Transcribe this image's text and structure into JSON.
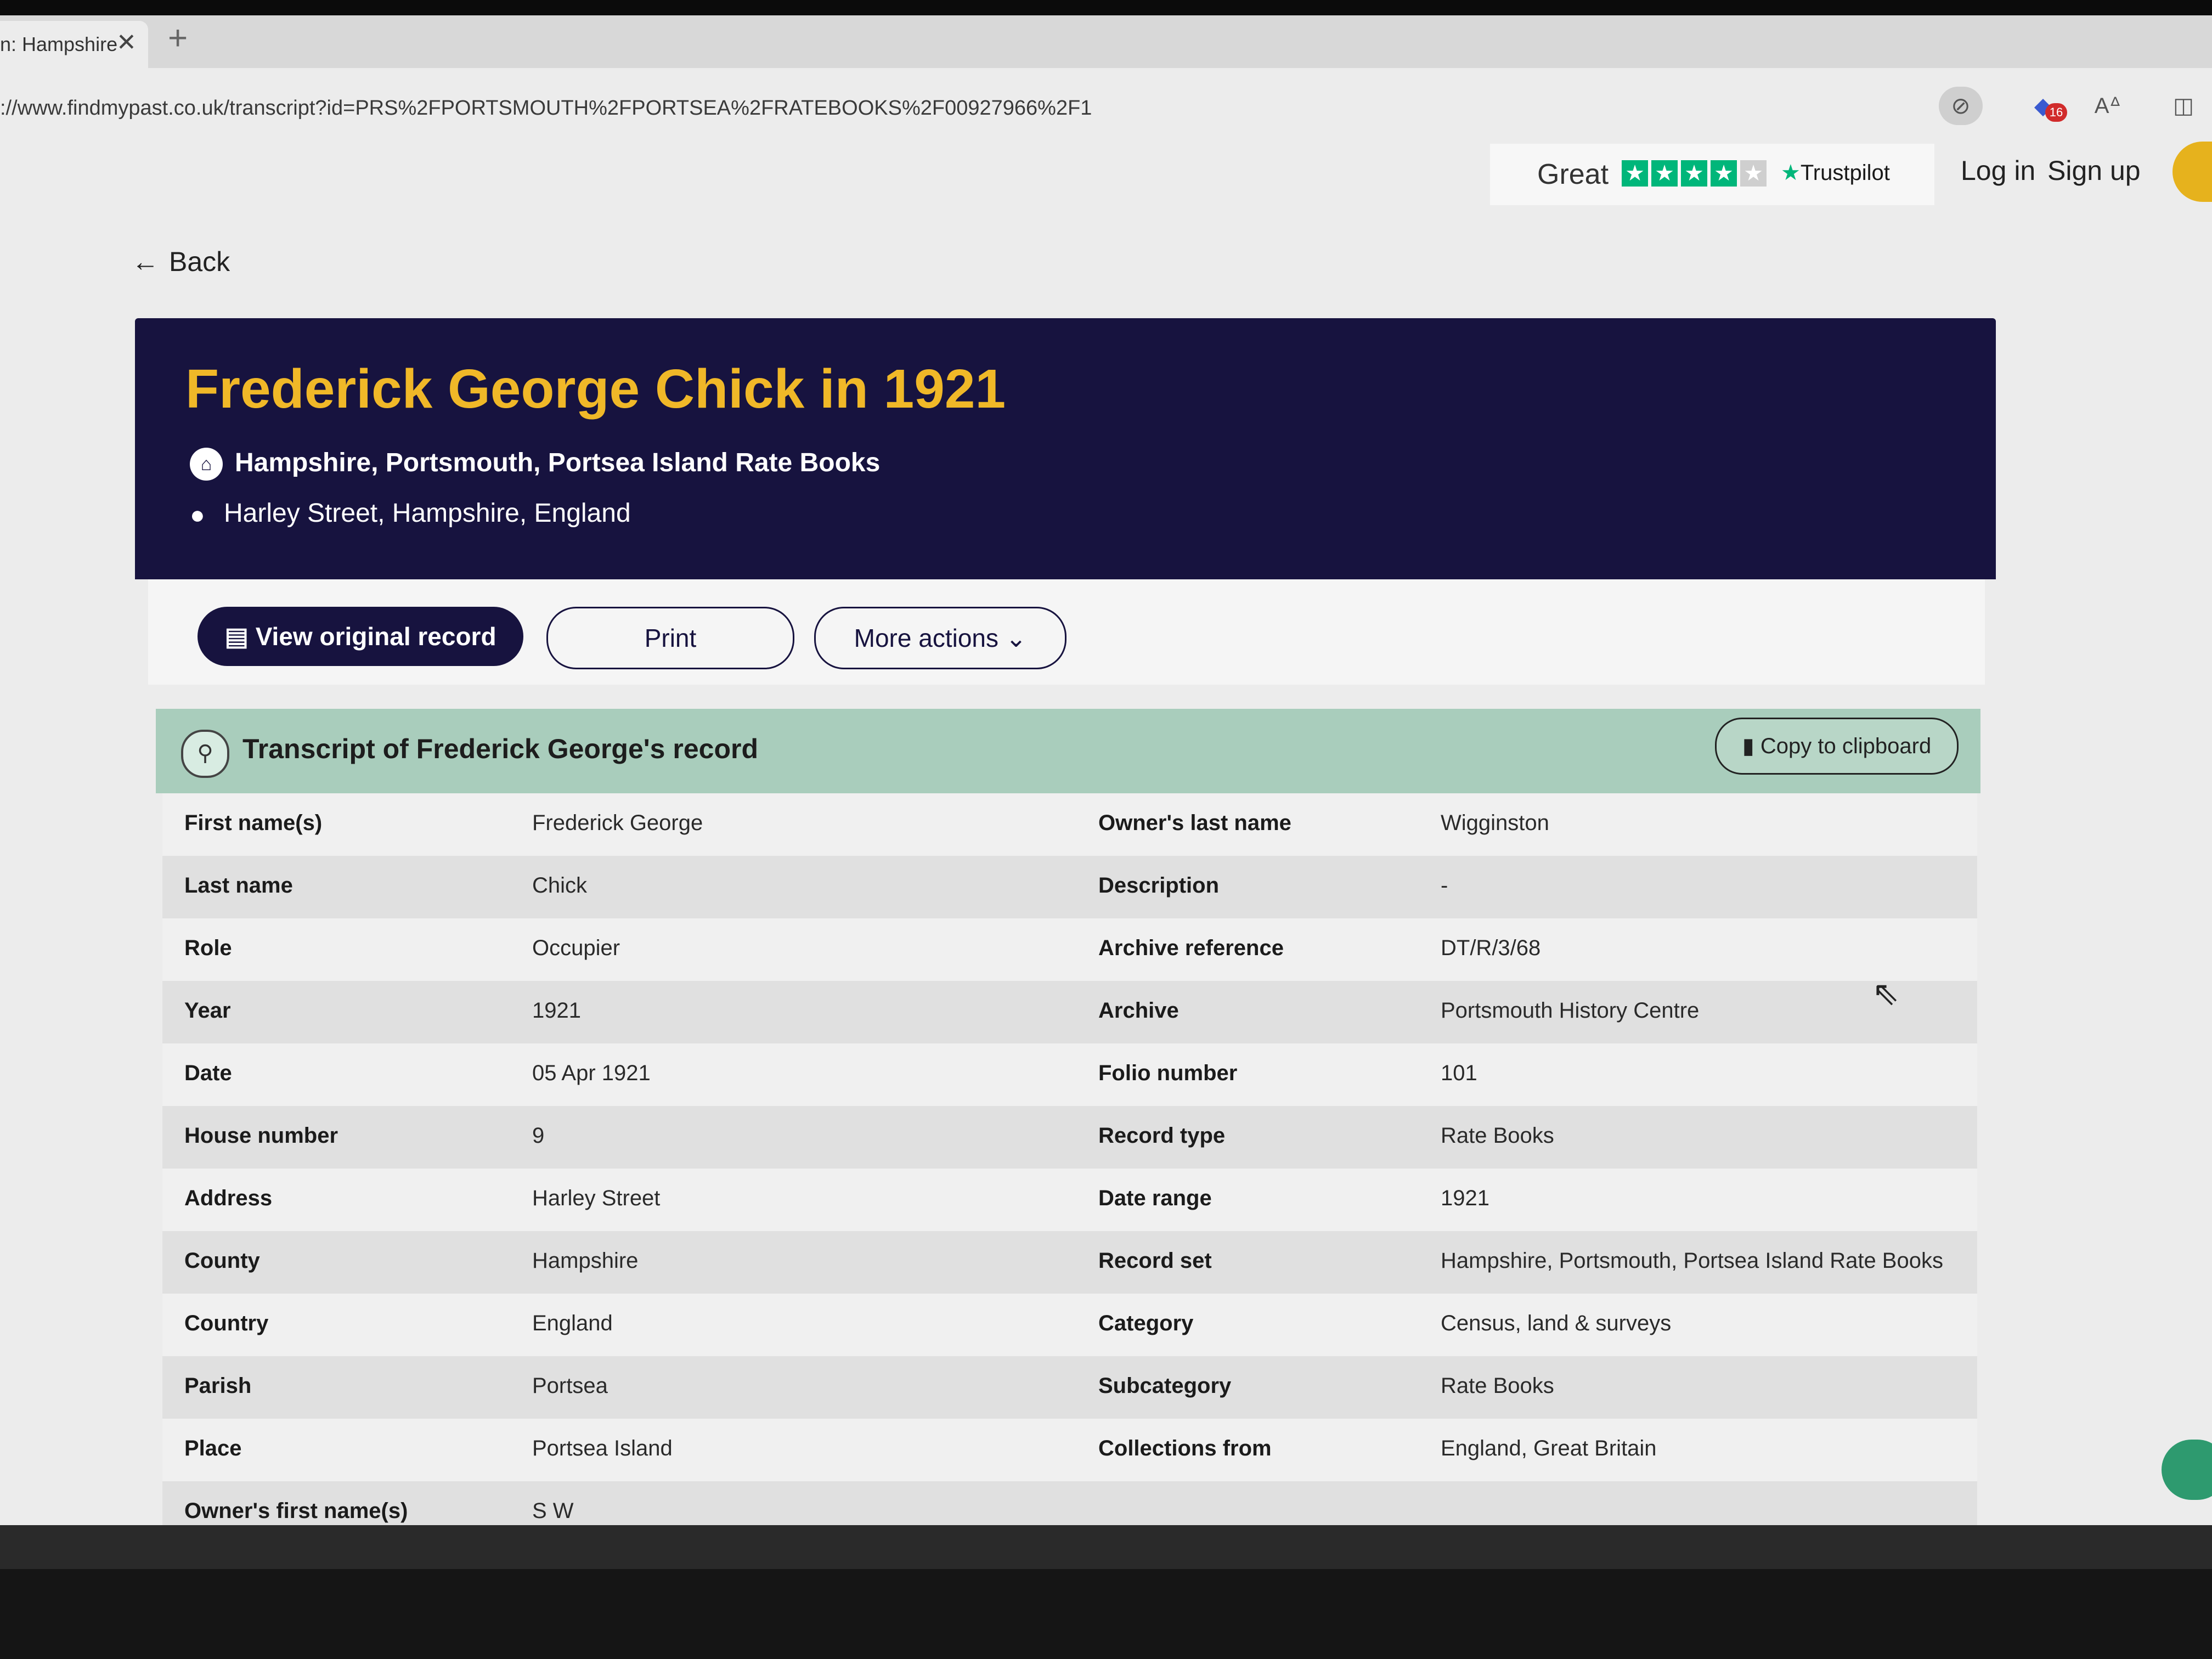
{
  "browser": {
    "tab_title": "n: Hampshire",
    "tab_close": "✕",
    "tab_new": "+",
    "url": "://www.findmypast.co.uk/transcript?id=PRS%2FPORTSMOUTH%2FPORTSEA%2FRATEBOOKS%2F00927966%2F1",
    "extension_badge": "16"
  },
  "topnav": {
    "trustpilot_rating": "Great",
    "trustpilot_stars": 4,
    "trustpilot_logo": "Trustpilot",
    "login": "Log in",
    "signup": "Sign up"
  },
  "back_label": "Back",
  "record": {
    "title": "Frederick George Chick in 1921",
    "collection": "Hampshire, Portsmouth, Portsea Island Rate Books",
    "location": "Harley Street, Hampshire, England"
  },
  "actions": {
    "view_original": "View original record",
    "print": "Print",
    "more_actions": "More actions"
  },
  "transcript": {
    "title": "Transcript of Frederick George's record",
    "copy_button": "Copy to clipboard",
    "left_rows": [
      {
        "label": "First name(s)",
        "value": "Frederick George"
      },
      {
        "label": "Last name",
        "value": "Chick"
      },
      {
        "label": "Role",
        "value": "Occupier"
      },
      {
        "label": "Year",
        "value": "1921"
      },
      {
        "label": "Date",
        "value": "05 Apr 1921"
      },
      {
        "label": "House number",
        "value": "9"
      },
      {
        "label": "Address",
        "value": "Harley Street"
      },
      {
        "label": "County",
        "value": "Hampshire"
      },
      {
        "label": "Country",
        "value": "England"
      },
      {
        "label": "Parish",
        "value": "Portsea"
      },
      {
        "label": "Place",
        "value": "Portsea Island"
      },
      {
        "label": "Owner's first name(s)",
        "value": "S W"
      }
    ],
    "right_rows": [
      {
        "label": "Owner's last name",
        "value": "Wigginston"
      },
      {
        "label": "Description",
        "value": "-"
      },
      {
        "label": "Archive reference",
        "value": "DT/R/3/68"
      },
      {
        "label": "Archive",
        "value": "Portsmouth History Centre"
      },
      {
        "label": "Folio number",
        "value": "101"
      },
      {
        "label": "Record type",
        "value": "Rate Books"
      },
      {
        "label": "Date range",
        "value": "1921"
      },
      {
        "label": "Record set",
        "value": "Hampshire, Portsmouth, Portsea Island Rate Books"
      },
      {
        "label": "Category",
        "value": "Census, land & surveys"
      },
      {
        "label": "Subcategory",
        "value": "Rate Books"
      },
      {
        "label": "Collections from",
        "value": "England, Great Britain"
      }
    ]
  },
  "icons": {
    "back": "arrow-left-icon",
    "collection": "archive-building-icon",
    "location": "map-pin-icon",
    "view_original": "document-icon",
    "more_actions": "chevron-down-icon",
    "transcript": "magnifier-person-icon",
    "copy": "clipboard-icon"
  }
}
